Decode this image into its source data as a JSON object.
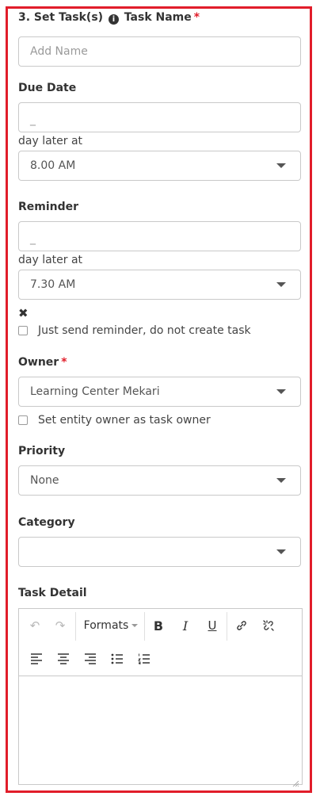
{
  "section": {
    "title": "3. Set Task(s)",
    "info_icon": "info-circle-icon",
    "task_name_label": "Task Name",
    "required_mark": "*"
  },
  "task_name": {
    "placeholder": "Add Name"
  },
  "due_date": {
    "label": "Due Date",
    "days_value": "_",
    "day_later_at": "day later at",
    "time_value": "8.00 AM"
  },
  "reminder": {
    "label": "Reminder",
    "days_value": "_",
    "day_later_at": "day later at",
    "time_value": "7.30 AM",
    "remove_icon": "close-icon",
    "only_reminder_label": "Just send reminder, do not create task"
  },
  "owner": {
    "label": "Owner",
    "required_mark": "*",
    "value": "Learning Center Mekari",
    "entity_owner_label": "Set entity owner as task owner"
  },
  "priority": {
    "label": "Priority",
    "value": "None"
  },
  "category": {
    "label": "Category",
    "value": ""
  },
  "task_detail": {
    "label": "Task Detail",
    "toolbar": {
      "formats_label": "Formats",
      "bold_label": "B",
      "italic_label": "I",
      "underline_label": "U"
    }
  },
  "colors": {
    "frame": "#e11d2a",
    "required": "#e11d2a"
  }
}
